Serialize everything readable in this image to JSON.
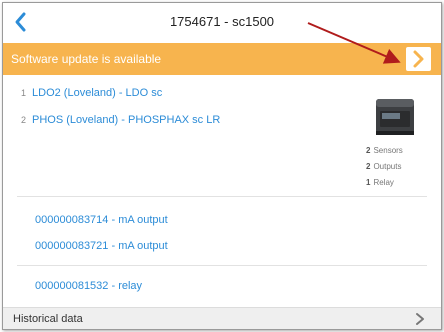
{
  "header": {
    "title": "1754671 - sc1500"
  },
  "banner": {
    "text": "Software update is available",
    "color": "#f7b44e"
  },
  "sensors": [
    {
      "num": "1",
      "name": "LDO2 (Loveland) - LDO sc"
    },
    {
      "num": "2",
      "name": "PHOS (Loveland) - PHOSPHAX sc LR"
    }
  ],
  "device_summary": [
    {
      "count": "2",
      "label": "Sensors"
    },
    {
      "count": "2",
      "label": "Outputs"
    },
    {
      "count": "1",
      "label": "Relay"
    }
  ],
  "outputs": [
    {
      "label": "000000083714 - mA output"
    },
    {
      "label": "000000083721 - mA output"
    }
  ],
  "relays": [
    {
      "label": "000000081532 - relay"
    }
  ],
  "footer": {
    "label": "Historical data"
  },
  "icons": {
    "back": "chevron-left-icon",
    "banner_action": "chevron-right-icon",
    "footer": "chevron-right-icon"
  },
  "colors": {
    "accent": "#2c8cd7",
    "banner": "#f7b44e",
    "annotation_arrow": "#b01c1c"
  }
}
